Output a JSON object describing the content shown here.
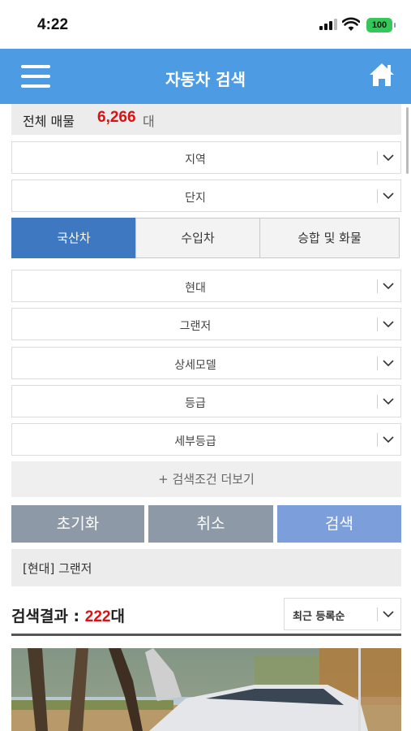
{
  "status_bar": {
    "time": "4:22",
    "battery": "100"
  },
  "header": {
    "title": "자동차 검색",
    "menu_icon": "hamburger-menu-icon",
    "home_icon": "home-icon",
    "color": "#4d9be2"
  },
  "total": {
    "label": "전체 매물",
    "count": "6,266",
    "unit": "대"
  },
  "filters": {
    "region": "지역",
    "complex": "단지",
    "maker": "현대",
    "model": "그랜저",
    "detail_model": "상세모델",
    "grade": "등급",
    "sub_grade": "세부등급"
  },
  "tabs": [
    {
      "label": "국산차",
      "active": true
    },
    {
      "label": "수입차",
      "active": false
    },
    {
      "label": "승합 및 화물",
      "active": false
    }
  ],
  "more_conditions": "+ 검색조건 더보기",
  "buttons": {
    "reset": "초기화",
    "cancel": "취소",
    "search": "검색"
  },
  "selected_summary": "[현대] 그랜저",
  "results": {
    "label": "검색결과 : ",
    "count": "222",
    "unit": "대",
    "sort": "최근 등록순"
  },
  "colors": {
    "accent": "#4d9be2",
    "tab_active": "#3d78c1",
    "highlight_red": "#dd1111",
    "search_button": "#7c9fdc",
    "gray_button": "#8e99a8"
  }
}
